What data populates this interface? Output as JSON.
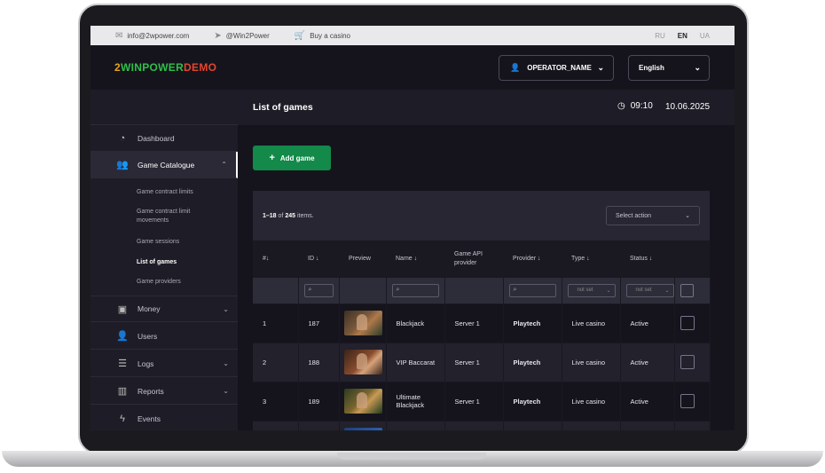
{
  "topbar": {
    "email": "info@2wpower.com",
    "telegram": "@Win2Power",
    "buy": "Buy a casino",
    "langs": [
      "RU",
      "EN",
      "UA"
    ],
    "active_lang": "EN"
  },
  "header": {
    "logo_part1": "2",
    "logo_part2": "WINPOWER",
    "logo_part3": "DEMO",
    "operator": "OPERATOR_NAME",
    "language": "English"
  },
  "sidebar": {
    "items": [
      {
        "label": "Dashboard",
        "icon": "dashboard-icon"
      },
      {
        "label": "Game Catalogue",
        "icon": "users-group-icon",
        "active": true
      },
      {
        "label": "Money",
        "icon": "money-icon"
      },
      {
        "label": "Users",
        "icon": "user-icon"
      },
      {
        "label": "Logs",
        "icon": "list-icon"
      },
      {
        "label": "Reports",
        "icon": "bar-chart-icon"
      },
      {
        "label": "Events",
        "icon": "lightning-icon"
      }
    ],
    "sub_items": [
      "Game contract limits",
      "Game contract limit movements",
      "Game sessions",
      "List of games",
      "Game providers"
    ],
    "active_sub": "List of games"
  },
  "page": {
    "title": "List of games",
    "time": "09:10",
    "date": "10.06.2025",
    "add_button": "Add game"
  },
  "table": {
    "summary_range": "1–18",
    "summary_of": "of",
    "summary_total": "245",
    "summary_suffix": "items.",
    "select_action": "Select action",
    "columns": [
      "#↓",
      "ID ↓",
      "Preview",
      "Name ↓",
      "Game API provider",
      "Provider ↓",
      "Type ↓",
      "Status ↓"
    ],
    "filter_not_set": "not set",
    "rows": [
      {
        "n": "1",
        "id": "187",
        "name": "Blackjack",
        "api": "Server 1",
        "provider": "Playtech",
        "type": "Live casino",
        "status": "Active"
      },
      {
        "n": "2",
        "id": "188",
        "name": "VIP Baccarat",
        "api": "Server 1",
        "provider": "Playtech",
        "type": "Live casino",
        "status": "Active"
      },
      {
        "n": "3",
        "id": "189",
        "name": "Ultimate Blackjack",
        "api": "Server 1",
        "provider": "Playtech",
        "type": "Live casino",
        "status": "Active"
      }
    ]
  },
  "colors": {
    "accent_green": "#13894a",
    "provider_blue": "#4d8dff",
    "status_green": "#2fbf4a",
    "bg_dark": "#15141c"
  }
}
